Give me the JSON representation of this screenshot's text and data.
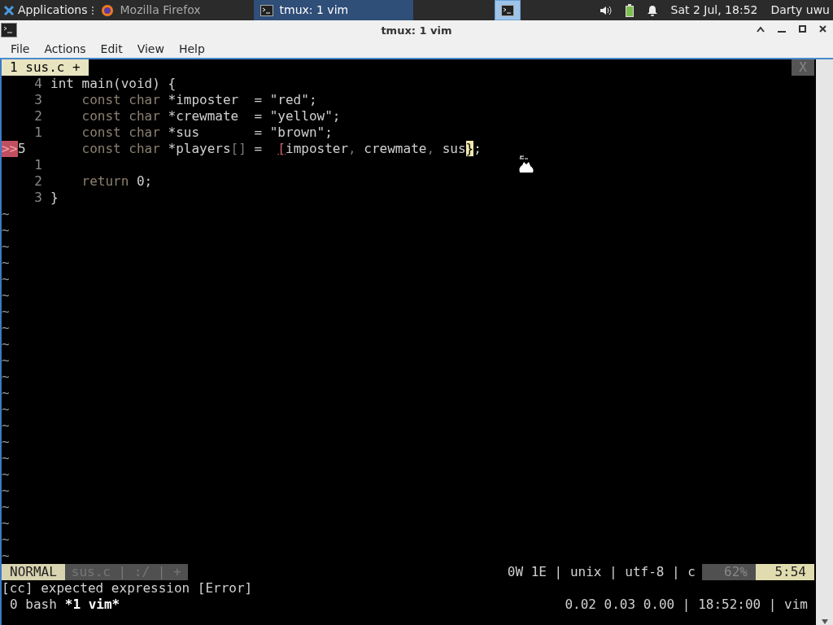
{
  "taskbar": {
    "apps_label": "Applications",
    "tasks": [
      {
        "label": "Mozilla Firefox",
        "kind": "browser",
        "selected": false
      },
      {
        "label": "tmux: 1 vim",
        "kind": "terminal",
        "selected": true
      }
    ],
    "clock": "Sat  2 Jul, 18:52",
    "user": "Darty uwu"
  },
  "window": {
    "title": "tmux: 1 vim"
  },
  "menu": [
    "File",
    "Actions",
    "Edit",
    "View",
    "Help"
  ],
  "vim": {
    "tabs": [
      {
        "label": "1 sus.c +",
        "selected": true
      }
    ],
    "close_label": "X",
    "lines": [
      {
        "number": "4",
        "current": false,
        "segments": [
          {
            "kind": "plain",
            "text": "int main(void) {"
          }
        ]
      },
      {
        "number": "3",
        "current": false,
        "segments": [
          {
            "kind": "keyword",
            "text": "    const char"
          },
          {
            "kind": "plain",
            "text": " *imposter  = \"red\";"
          }
        ]
      },
      {
        "number": "2",
        "current": false,
        "segments": [
          {
            "kind": "keyword",
            "text": "    const char"
          },
          {
            "kind": "plain",
            "text": " *crewmate  = \"yellow\";"
          }
        ]
      },
      {
        "number": "1",
        "current": false,
        "segments": [
          {
            "kind": "keyword",
            "text": "    const char"
          },
          {
            "kind": "plain",
            "text": " *sus       = \"brown\";"
          }
        ]
      },
      {
        "sign": ">>",
        "number": "5",
        "current": true,
        "segments": [
          {
            "kind": "keyword",
            "text": "    const char"
          },
          {
            "kind": "plain",
            "text": " *players"
          },
          {
            "kind": "dim",
            "text": "[]"
          },
          {
            "kind": "plain",
            "text": " =  "
          },
          {
            "kind": "error",
            "text": "["
          },
          {
            "kind": "plain",
            "text": "imposter"
          },
          {
            "kind": "dim",
            "text": ","
          },
          {
            "kind": "plain",
            "text": " crewmate"
          },
          {
            "kind": "dim",
            "text": ","
          },
          {
            "kind": "plain",
            "text": " sus"
          },
          {
            "kind": "cursor",
            "text": "}"
          },
          {
            "kind": "plain",
            "text": ";"
          }
        ]
      },
      {
        "number": "1",
        "current": false
      },
      {
        "number": "2",
        "current": false,
        "segments": [
          {
            "kind": "keyword",
            "text": "    return"
          },
          {
            "kind": "plain",
            "text": " 0;"
          }
        ]
      },
      {
        "number": "3",
        "current": false,
        "segments": [
          {
            "kind": "plain",
            "text": "}"
          }
        ]
      }
    ],
    "tildes": [
      "~",
      "~",
      "~",
      "~",
      "~",
      "~",
      "~",
      "~",
      "~",
      "~",
      "~",
      "~",
      "~",
      "~",
      "~",
      "~",
      "~",
      "~",
      "~",
      "~",
      "~",
      "~"
    ],
    "status": {
      "mode": "NORMAL",
      "file": "sus.c | :/ | +",
      "info": "0W 1E | unix | utf-8 | c",
      "percent": "62%",
      "position": "5:54"
    },
    "message": "[cc] expected expression [Error]"
  },
  "tmux": {
    "windows": [
      {
        "label": "0 bash",
        "selected": false
      },
      {
        "label": "*1 vim*",
        "selected": true
      }
    ],
    "right": "0.02 0.03 0.00 | 18:52:00 | vim"
  }
}
